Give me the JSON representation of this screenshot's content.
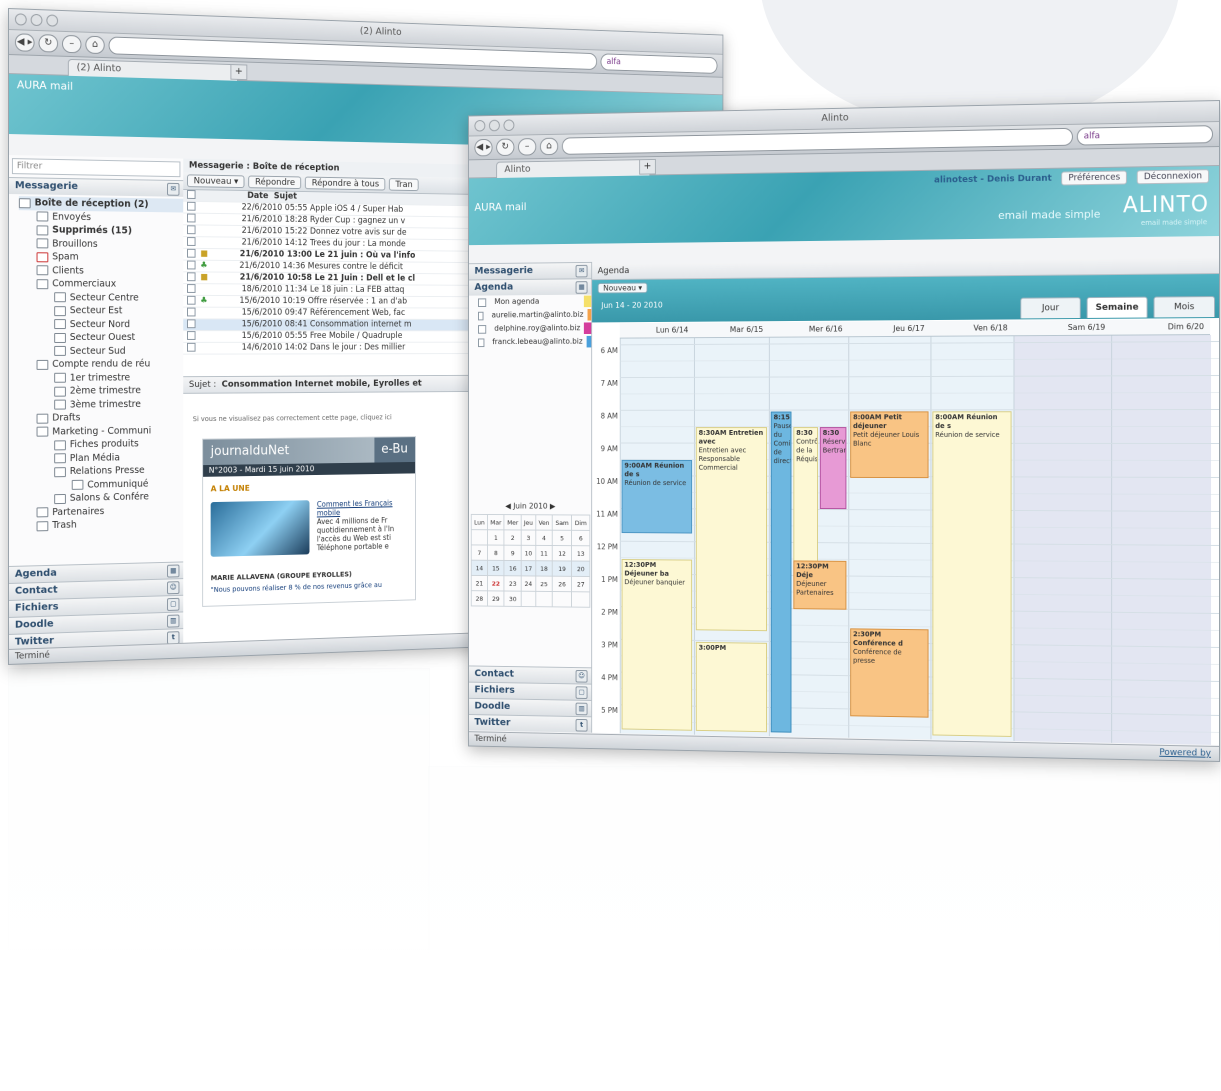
{
  "back_window": {
    "title": "(2) Alinto",
    "tab_title": "(2) Alinto",
    "search_engine": "alfa",
    "app_name": "AURA mail",
    "filter_placeholder": "Filtrer",
    "sections": [
      "Messagerie",
      "Agenda",
      "Contact",
      "Fichiers",
      "Doodle",
      "Twitter"
    ],
    "folders": [
      "Boîte de réception (2)",
      "Envoyés",
      "Supprimés (15)",
      "Brouillons",
      "Spam",
      "Clients",
      "Commerciaux",
      "Secteur Centre",
      "Secteur Est",
      "Secteur Nord",
      "Secteur Ouest",
      "Secteur Sud",
      "Compte rendu de réu",
      "1er trimestre",
      "2ème trimestre",
      "3ème trimestre",
      "Drafts",
      "Marketing - Communi",
      "Fiches produits",
      "Plan Média",
      "Relations Presse",
      "Communiqué",
      "Salons & Confére",
      "Partenaires",
      "Trash"
    ],
    "mailbox_title": "Messagerie : Boîte de réception",
    "toolbar": [
      "Nouveau ▾",
      "Répondre",
      "Répondre à tous",
      "Tran"
    ],
    "columns": [
      "Date",
      "Sujet"
    ],
    "emails": [
      "22/6/2010 05:55 Apple iOS 4 / Super Hab",
      "21/6/2010 18:28 Ryder Cup : gagnez un v",
      "21/6/2010 15:22 Donnez votre avis sur de",
      "21/6/2010 14:12 Trees du jour : La monde",
      "21/6/2010 13:00 Le 21 juin : Où va l'info",
      "21/6/2010 14:36 Mesures contre le déficit",
      "21/6/2010 10:58 Le 21 Juin : Dell et le cl",
      "18/6/2010 11:34 Le 18 juin : La FEB attaq",
      "15/6/2010 10:19 Offre réservée : 1 an d'ab",
      "15/6/2010 09:47 Référencement Web, fac",
      "15/6/2010 08:41 Consommation internet m",
      "15/6/2010 05:55 Free Mobile / Quadruple",
      "14/6/2010 14:02 Dans le jour : Des millier"
    ],
    "preview_subject_label": "Sujet :",
    "preview_subject": "Consommation Internet mobile, Eyrolles et",
    "preview_notice": "Si vous ne visualisez pas correctement cette page, cliquez ici",
    "newsletter_name": "journalduNet",
    "newsletter_badge": "e-Bu",
    "newsletter_issue": "N°2003 - Mardi 15 juin 2010",
    "newsletter_section": "A LA UNE",
    "newsletter_headline": "Comment les Français mobile",
    "newsletter_text": "Avec 4 millions de Fr quotidiennement à l'In l'accès du Web est sti Téléphone portable e",
    "newsletter_footer": "MARIE ALLAVENA (GROUPE EYROLLES)",
    "newsletter_quote": "\"Nous pouvons réaliser 8 % de nos revenus grâce au",
    "status": "Terminé"
  },
  "front_window": {
    "title": "Alinto",
    "tab_title": "Alinto",
    "search_engine": "alfa",
    "user": "alinotest - Denis Durant",
    "prefs_label": "Préférences",
    "logout_label": "Déconnexion",
    "app_name": "AURA mail",
    "tagline": "email made simple",
    "logo": "ALINTO",
    "logo_sub": "email made simple",
    "sections_top": [
      "Messagerie",
      "Agenda"
    ],
    "sections_bottom": [
      "Contact",
      "Fichiers",
      "Doodle",
      "Twitter"
    ],
    "calendars": [
      {
        "label": "Mon agenda",
        "color": "#f5e06a"
      },
      {
        "label": "aurelie.martin@alinto.biz",
        "color": "#f4a24a"
      },
      {
        "label": "delphine.roy@alinto.biz",
        "color": "#d43d9c"
      },
      {
        "label": "franck.lebeau@alinto.biz",
        "color": "#4aa0dc"
      }
    ],
    "mini_cal": {
      "month": "Juin 2010",
      "weekdays": [
        "Lun",
        "Mar",
        "Mer",
        "Jeu",
        "Ven",
        "Sam",
        "Dim"
      ],
      "weeks": [
        [
          "",
          "1",
          "2",
          "3",
          "4",
          "5",
          "6"
        ],
        [
          "7",
          "8",
          "9",
          "10",
          "11",
          "12",
          "13"
        ],
        [
          "14",
          "15",
          "16",
          "17",
          "18",
          "19",
          "20"
        ],
        [
          "21",
          "22",
          "23",
          "24",
          "25",
          "26",
          "27"
        ],
        [
          "28",
          "29",
          "30",
          "",
          "",
          "",
          ""
        ]
      ]
    },
    "agenda_title": "Agenda",
    "new_button": "Nouveau ▾",
    "date_range": "Jun 14 - 20 2010",
    "view_tabs": [
      "Jour",
      "Semaine",
      "Mois"
    ],
    "days": [
      "Lun 6/14",
      "Mar 6/15",
      "Mer 6/16",
      "Jeu 6/17",
      "Ven 6/18",
      "Sam 6/19",
      "Dim 6/20"
    ],
    "hours": [
      "6 AM",
      "7 AM",
      "8 AM",
      "9 AM",
      "10 AM",
      "11 AM",
      "12 PM",
      "1 PM",
      "2 PM",
      "3 PM",
      "4 PM",
      "5 PM"
    ],
    "events": [
      {
        "title": "9:00AM Réunion de s",
        "body": "Réunion de service"
      },
      {
        "title": "8:30AM Entretien avec",
        "body": "Entretien avec Responsable Commercial"
      },
      {
        "title": "8:15",
        "body": "Pause du Comité de direction"
      },
      {
        "title": "8:30",
        "body": "Contrôle de la Réquisition"
      },
      {
        "title": "8:30",
        "body": "Réserve Bertrand"
      },
      {
        "title": "8:00AM Petit déjeuner",
        "body": "Petit déjeuner Louis Blanc"
      },
      {
        "title": "8:00AM Réunion de s",
        "body": "Réunion de service"
      },
      {
        "title": "12:30PM Déjeuner ba",
        "body": "Déjeuner banquier"
      },
      {
        "title": "12:30PM Déje",
        "body": "Déjeuner Partenaires"
      },
      {
        "title": "3:00PM",
        "body": ""
      },
      {
        "title": "2:30PM Conférence d",
        "body": "Conférence de presse"
      }
    ],
    "status": "Terminé",
    "powered": "Powered by"
  }
}
